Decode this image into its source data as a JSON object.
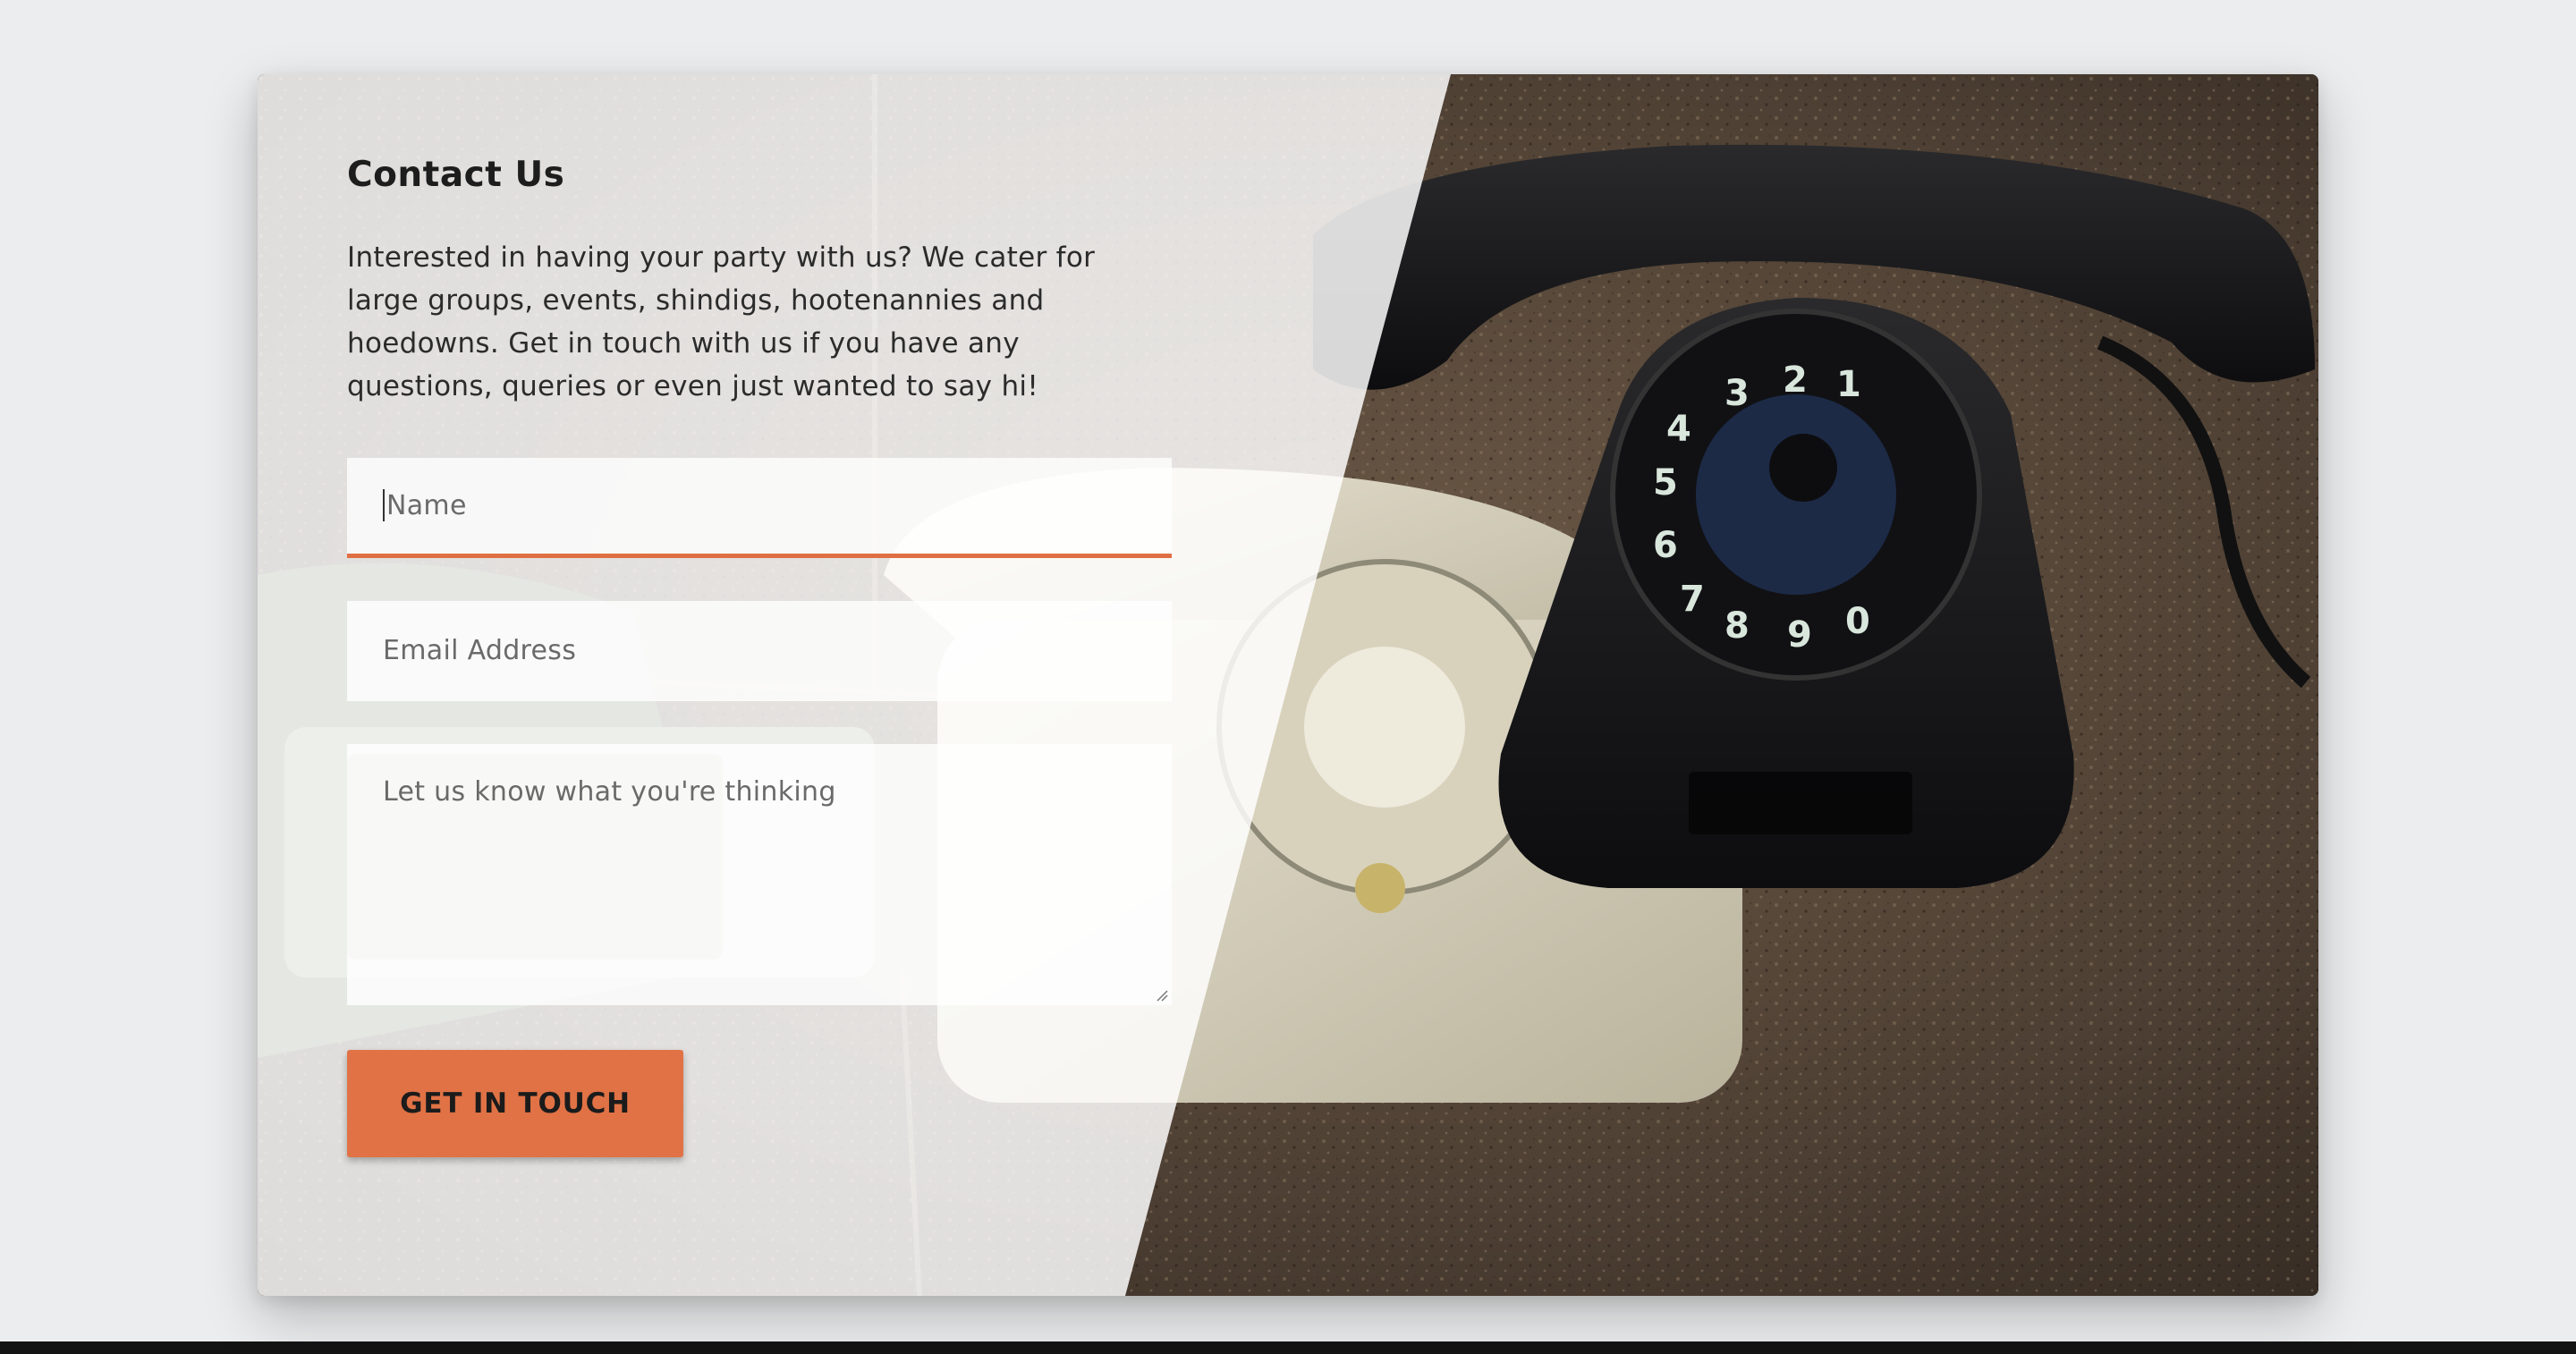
{
  "contact": {
    "title": "Contact Us",
    "intro": "Interested in having your party with us? We cater for large groups, events, shindigs, hootenannies and hoedowns. Get in touch with us if you have any questions, queries or even just wanted to say hi!",
    "name_placeholder": "Name",
    "email_placeholder": "Email Address",
    "message_placeholder": "Let us know what you're thinking",
    "submit_label": "GET IN TOUCH"
  },
  "colors": {
    "accent": "#e07245",
    "background": "#ecedee",
    "overlay": "rgba(255,255,255,0.84)"
  },
  "icons": {
    "resize": "resize-grip-icon"
  }
}
